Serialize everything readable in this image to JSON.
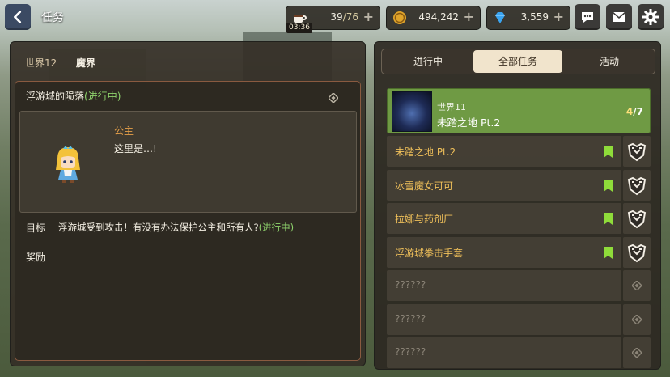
{
  "header": {
    "back_icon": "back-arrow-icon",
    "title": "任务",
    "stamina": {
      "icon": "coffee-cup-icon",
      "current": "39",
      "max": "/76",
      "timer": "03:36"
    },
    "meso": {
      "icon": "coin-icon",
      "value": "494,242"
    },
    "gems": {
      "icon": "gem-icon",
      "value": "3,559"
    },
    "plus": "+",
    "buttons": [
      "chat-icon",
      "mail-icon",
      "gear-icon"
    ]
  },
  "left_panel": {
    "world": "世界12",
    "map": "魔界",
    "quest": {
      "name": "浮游城的陨落",
      "status": "(进行中)",
      "speaker": "公主",
      "dialogue": "这里是…!",
      "goal_label": "目标",
      "goal_text": "浮游城受到攻击！有没有办法保护公主和所有人?",
      "goal_status": "(进行中)",
      "reward_label": "奖励"
    }
  },
  "right_panel": {
    "tabs": [
      "进行中",
      "全部任务",
      "活动"
    ],
    "active_tab": 1,
    "highlight": {
      "world": "世界11",
      "name": "未踏之地  Pt.2",
      "progress": "4",
      "total": "/7"
    },
    "quests": [
      {
        "name": "未踏之地  Pt.2",
        "locked": false
      },
      {
        "name": "冰雪魔女可可",
        "locked": false
      },
      {
        "name": "拉娜与药剂厂",
        "locked": false
      },
      {
        "name": "浮游城拳击手套",
        "locked": false
      },
      {
        "name": "??????",
        "locked": true
      },
      {
        "name": "??????",
        "locked": true
      },
      {
        "name": "??????",
        "locked": true
      }
    ]
  },
  "colors": {
    "accent_green": "#6f9a44",
    "status_green": "#8fd46d",
    "quest_gold": "#f0c05a",
    "speaker_orange": "#e6a04a"
  }
}
